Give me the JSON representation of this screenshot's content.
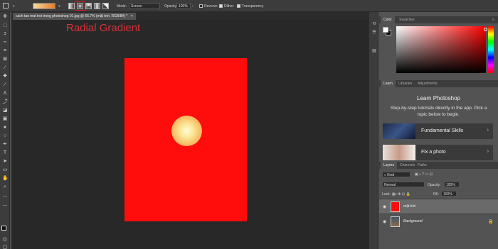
{
  "options_bar": {
    "mode_label": "Mode:",
    "mode_value": "Screen",
    "opacity_label": "Opacity:",
    "opacity_value": "100%",
    "reverse_label": "Reverse",
    "dither_label": "Dither",
    "transparency_label": "Transparency",
    "reverse_checked": false,
    "dither_checked": true,
    "transparency_checked": true
  },
  "document_tab": {
    "label": "cach tao mat troi trong photoshop 01.jpg @ 66.7% (mặt trời, RGB/8#) *",
    "close": "×"
  },
  "annotation": {
    "text": "Radial Gradient",
    "color": "#d4323c"
  },
  "canvas": {
    "document_color": "#ff0d0d"
  },
  "color_panel": {
    "tabs": [
      "Color",
      "Swatches"
    ],
    "hue": "#ff0000"
  },
  "learn_panel": {
    "tabs": [
      "Learn",
      "Libraries",
      "Adjustments"
    ],
    "title": "Learn Photoshop",
    "description": "Step-by-step tutorials directly in the app. Pick a topic below to begin.",
    "cards": [
      {
        "title": "Fundamental Skills",
        "chevron": "›"
      },
      {
        "title": "Fix a photo",
        "chevron": "›"
      }
    ]
  },
  "layers_panel": {
    "tabs": [
      "Layers",
      "Channels",
      "Paths"
    ],
    "filter_kind": "Kind",
    "blend_mode": "Normal",
    "opacity_label": "Opacity:",
    "opacity_value": "100%",
    "lock_label": "Lock:",
    "fill_label": "Fill:",
    "fill_value": "100%",
    "layers": [
      {
        "name": "mặt trời",
        "selected": true,
        "locked": false
      },
      {
        "name": "Background",
        "selected": false,
        "locked": true
      }
    ]
  }
}
